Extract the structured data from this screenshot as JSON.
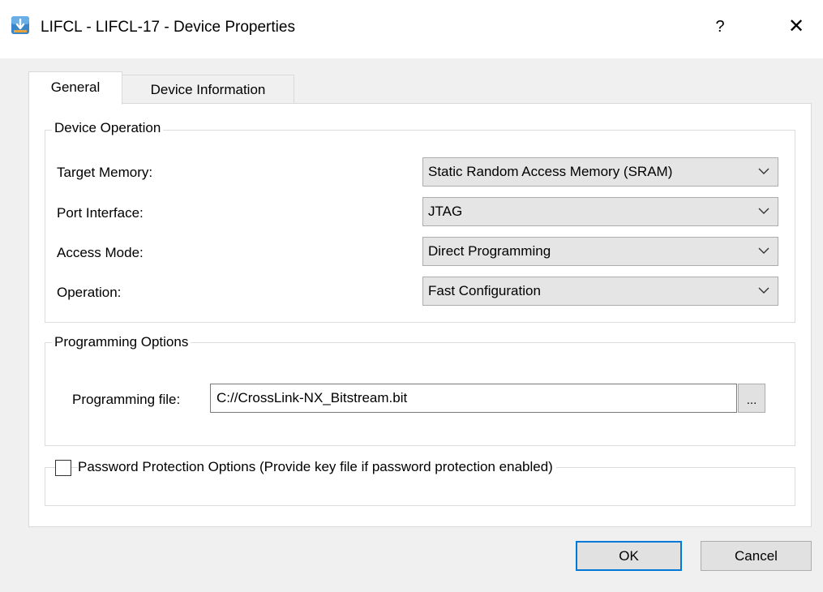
{
  "window": {
    "title": "LIFCL - LIFCL-17 - Device Properties",
    "help_glyph": "?",
    "close_glyph": "✕"
  },
  "tabs": [
    {
      "label": "General",
      "selected": true
    },
    {
      "label": "Device Information",
      "selected": false
    }
  ],
  "device_operation": {
    "legend": "Device Operation",
    "target_memory": {
      "label": "Target Memory:",
      "value": "Static Random Access Memory (SRAM)"
    },
    "port_interface": {
      "label": "Port Interface:",
      "value": "JTAG"
    },
    "access_mode": {
      "label": "Access Mode:",
      "value": "Direct Programming"
    },
    "operation": {
      "label": "Operation:",
      "value": "Fast Configuration"
    }
  },
  "programming_options": {
    "legend": "Programming Options",
    "file_label": "Programming file:",
    "file_value": "C://CrossLink-NX_Bitstream.bit",
    "browse_label": "..."
  },
  "password_protection": {
    "label": "Password Protection Options (Provide key file if password protection enabled)",
    "checked": false
  },
  "buttons": {
    "ok": "OK",
    "cancel": "Cancel"
  },
  "colors": {
    "window_bg": "#f0f0f0",
    "panel_bg": "#ffffff",
    "combo_bg": "#e5e5e5",
    "default_button_border": "#0078d7"
  },
  "icons": {
    "app": "lattice-diamond-app-icon",
    "dropdown": "chevron-down-icon"
  }
}
